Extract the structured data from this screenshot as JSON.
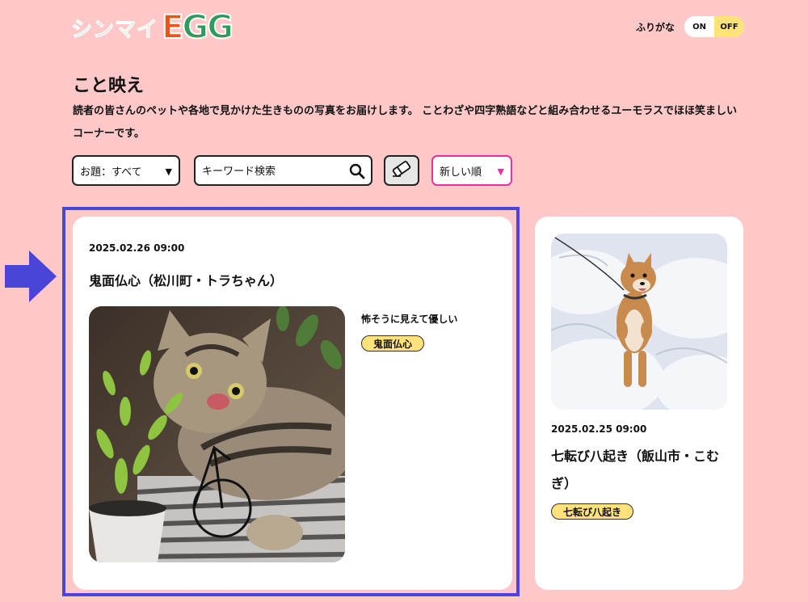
{
  "header": {
    "logo_kana": [
      "シ",
      "ン",
      "マ",
      "イ"
    ],
    "logo_kana_colors": [
      "#3fb8a8",
      "#e8495b",
      "#6bb84a",
      "#f0a02c"
    ],
    "logo_egg": [
      "E",
      "G",
      "G"
    ],
    "logo_egg_colors": [
      "#e8541d",
      "#2f9a5c",
      "#2f9a5c"
    ],
    "furigana_label": "ふりがな",
    "toggle_on": "ON",
    "toggle_off": "OFF"
  },
  "page": {
    "title": "こと映え",
    "description": "読者の皆さんのペットや各地で見かけた生きものの写真をお届けします。 ことわざや四字熟語などと組み合わせるユーモラスでほほ笑ましいコーナーです。"
  },
  "filters": {
    "topic_value": "お題：すべて",
    "search_placeholder": "キーワード検索",
    "sort_value": "新しい順"
  },
  "posts": [
    {
      "date": "2025.02.26 09:00",
      "title": "鬼面仏心（松川町・トラちゃん）",
      "caption": "怖そうに見えて優しい",
      "tag": "鬼面仏心"
    },
    {
      "date": "2025.02.25 09:00",
      "title": "七転び八起き（飯山市・こむぎ）",
      "tag": "七転び八起き"
    }
  ],
  "colors": {
    "background": "#ffc8c8",
    "highlight": "#4a45d6",
    "tag": "#ffe27a",
    "sort_border": "#e8329a"
  },
  "icons": [
    "search-icon",
    "eraser-icon",
    "arrow-right-icon"
  ]
}
